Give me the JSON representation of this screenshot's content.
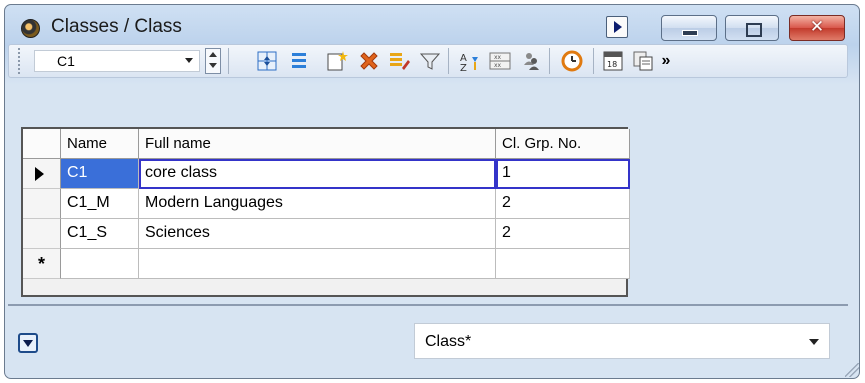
{
  "window": {
    "title": "Classes / Class"
  },
  "toolbar": {
    "selector_value": "C1",
    "overflow_label": "»",
    "date_icon_text": "18"
  },
  "grid": {
    "columns": [
      "Name",
      "Full name",
      "Cl. Grp. No."
    ],
    "rows": [
      {
        "name": "C1",
        "full_name": "core class",
        "grp": "1"
      },
      {
        "name": "C1_M",
        "full_name": "Modern Languages",
        "grp": "2"
      },
      {
        "name": "C1_S",
        "full_name": "Sciences",
        "grp": "2"
      }
    ],
    "new_row_marker": "*"
  },
  "footer": {
    "view_value": "Class*"
  },
  "colors": {
    "selection_outline": "#3434c9",
    "close_button": "#d9564a",
    "window_chrome": "#bcd2ec"
  }
}
